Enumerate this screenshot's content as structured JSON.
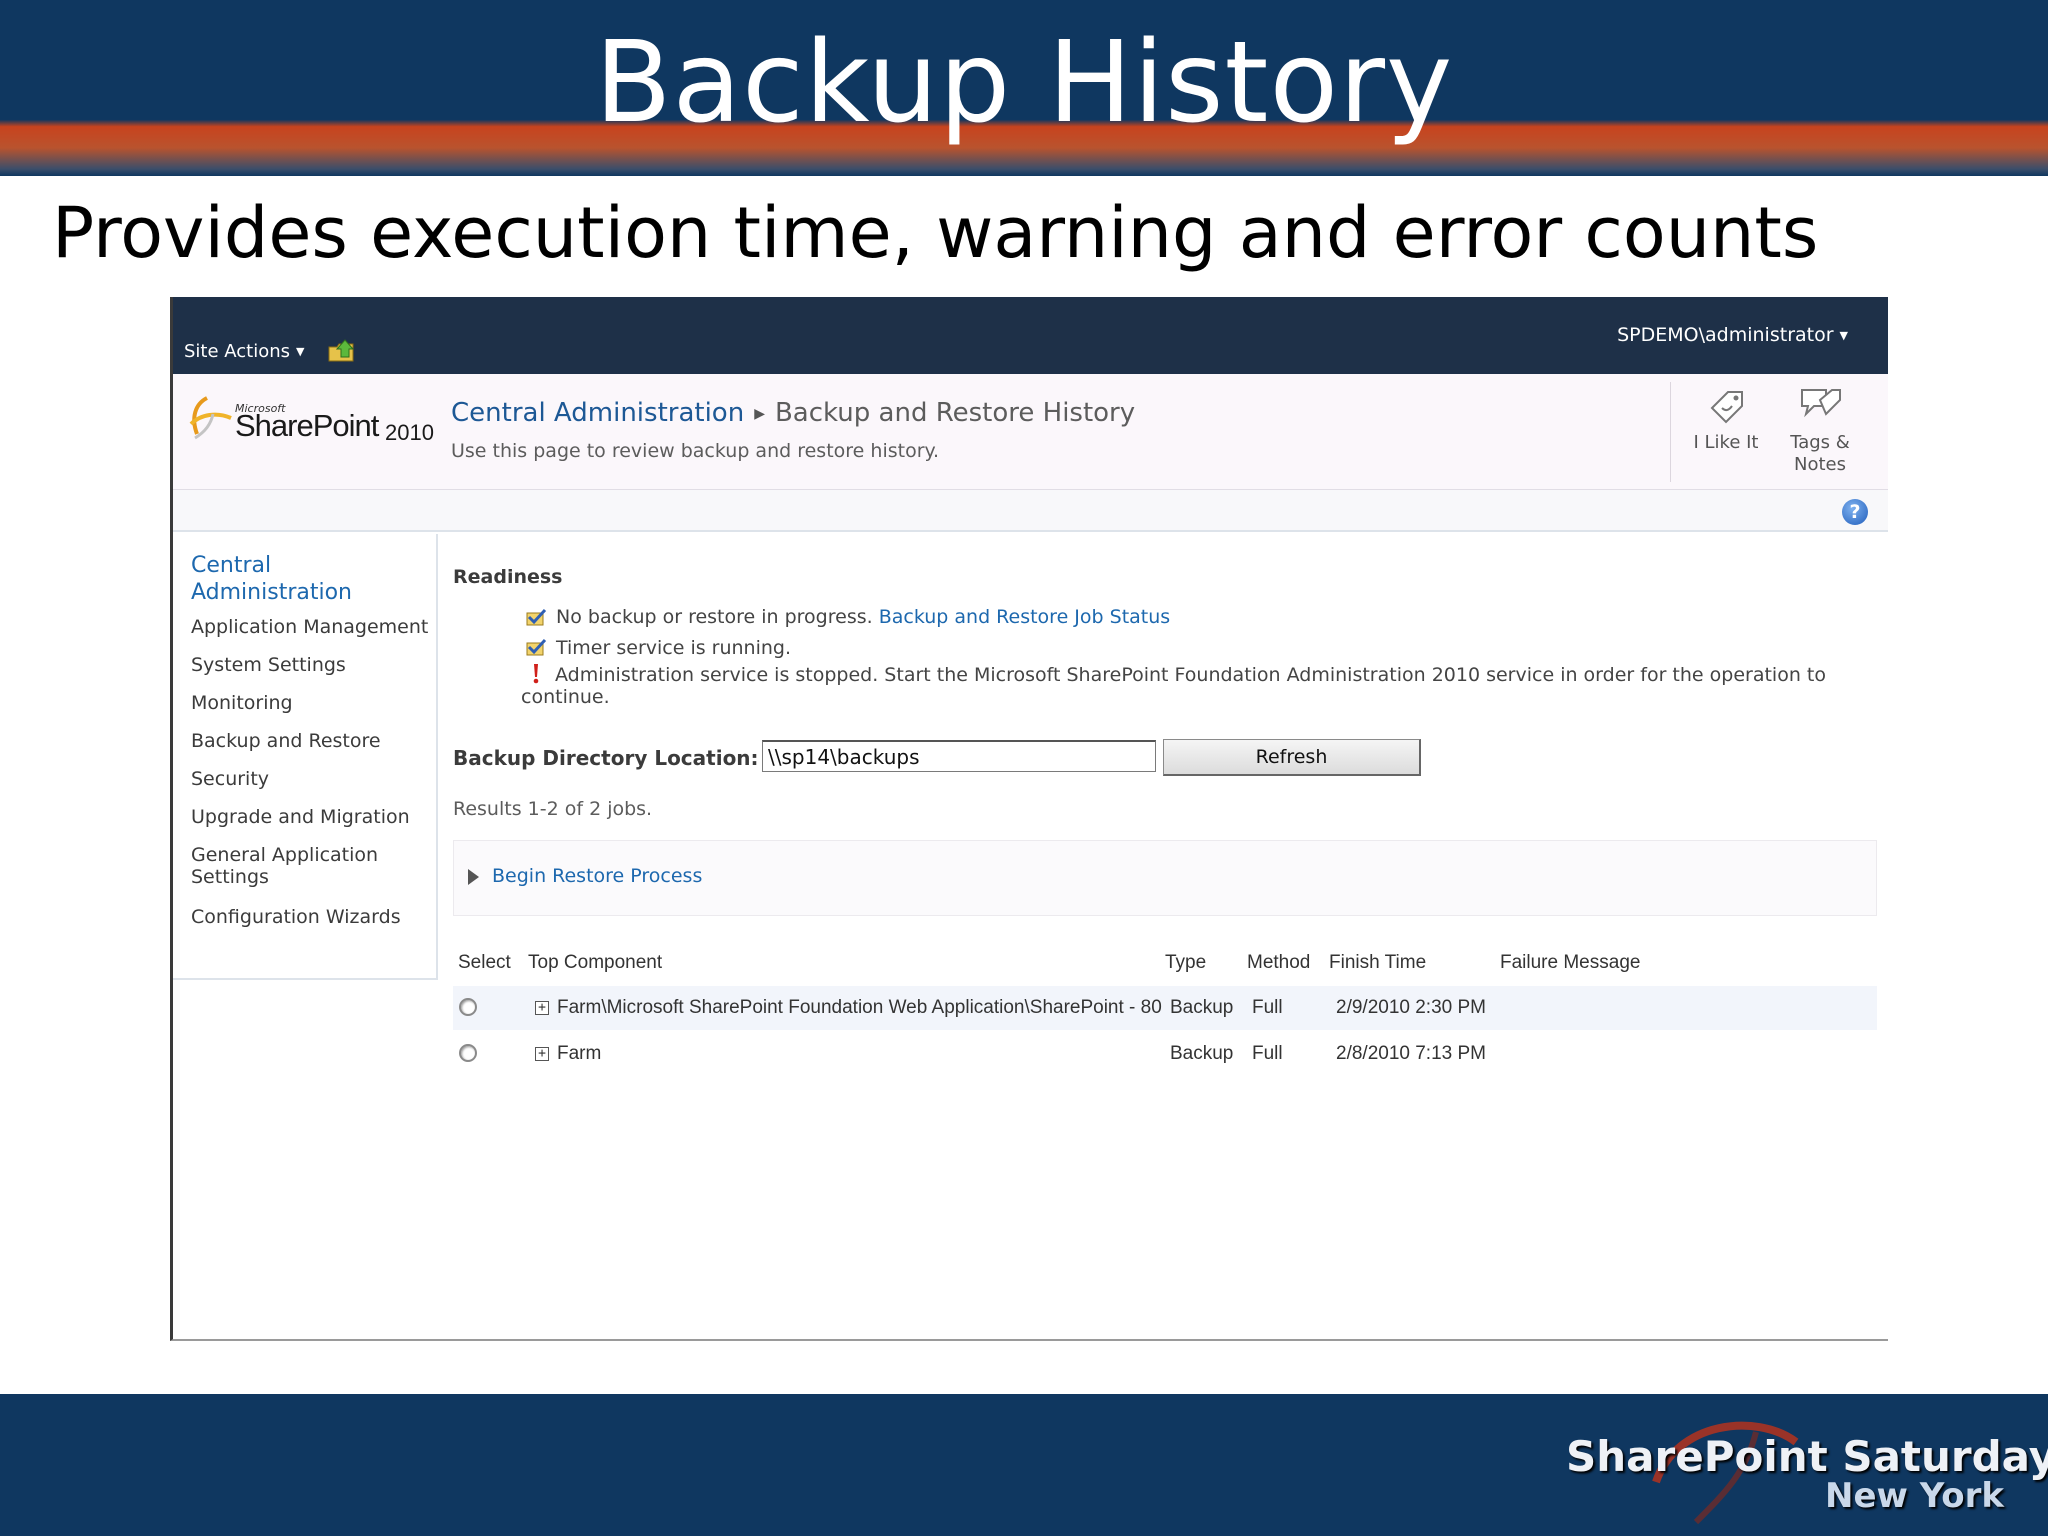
{
  "slide": {
    "title": "Backup History",
    "subtitle": "Provides execution time, warning and error counts",
    "logo_line1": "SharePoint Saturday",
    "logo_line2": "New York"
  },
  "ribbon": {
    "site_actions": "Site Actions",
    "user": "SPDEMO\\administrator"
  },
  "title_area": {
    "logo_microsoft": "Microsoft",
    "logo_product": "SharePoint",
    "logo_year": "2010",
    "breadcrumb_root": "Central Administration",
    "breadcrumb_page": "Backup and Restore History",
    "description": "Use this page to review backup and restore history.",
    "like_label_1": "I Like It",
    "tags_label_1": "Tags &",
    "tags_label_2": "Notes",
    "help_glyph": "?"
  },
  "quick_launch": {
    "heading": "Central Administration",
    "items": [
      "Application Management",
      "System Settings",
      "Monitoring",
      "Backup and Restore",
      "Security",
      "Upgrade and Migration",
      "General Application Settings",
      "Configuration Wizards"
    ]
  },
  "readiness": {
    "title": "Readiness",
    "line1_text": "No backup or restore in progress. ",
    "line1_link": "Backup and Restore Job Status",
    "line2_text": "Timer service is running.",
    "line3_text": "Administration service is stopped. Start the Microsoft SharePoint Foundation Administration 2010 service in order for the operation to continue."
  },
  "backup_dir": {
    "label": "Backup Directory Location:",
    "value": "\\\\sp14\\backups",
    "refresh_label": "Refresh"
  },
  "results_text": "Results 1-2 of 2 jobs.",
  "restore_link": "Begin Restore Process",
  "jobs": {
    "columns": [
      "Select",
      "Top Component",
      "Type",
      "Method",
      "Finish Time",
      "Failure Message"
    ],
    "rows": [
      {
        "component": "Farm\\Microsoft SharePoint Foundation Web Application\\SharePoint - 80",
        "type": "Backup",
        "method": "Full",
        "finish": "2/9/2010 2:30 PM",
        "failure": ""
      },
      {
        "component": "Farm",
        "type": "Backup",
        "method": "Full",
        "finish": "2/8/2010 7:13 PM",
        "failure": ""
      }
    ]
  },
  "colors": {
    "slide_navy": "#0f3760",
    "slide_orange": "#c8431e",
    "ribbon": "#1e3048",
    "link_blue": "#1d68ae",
    "alt_row": "#f2f5fb"
  }
}
